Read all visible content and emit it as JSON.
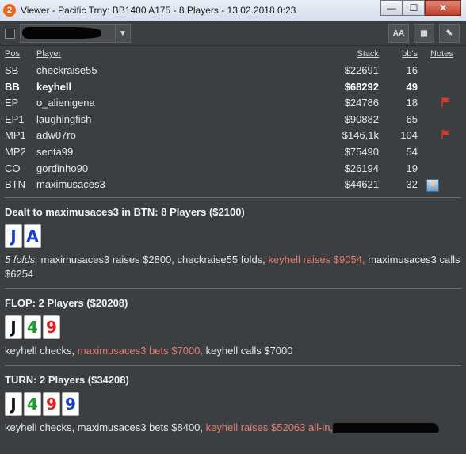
{
  "window": {
    "icon_label": "2",
    "title": "Viewer - Pacific Trny: BB1400 A175 - 8 Players - 13.02.2018 0:23",
    "min_label": "—",
    "max_label": "☐",
    "close_label": "✕"
  },
  "toolbar": {
    "dropdown_arrow": "▼",
    "font_button": "AA",
    "grid_button": "▦",
    "edit_button": "✎"
  },
  "table_header": {
    "pos": "Pos",
    "player": "Player",
    "stack": "Stack",
    "bbs": "bb's",
    "notes": "Notes"
  },
  "players": [
    {
      "pos": "SB",
      "name": "checkraise55",
      "stack": "$22691",
      "bbs": "16",
      "note": "",
      "bold": false
    },
    {
      "pos": "BB",
      "name": "keyhell",
      "stack": "$68292",
      "bbs": "49",
      "note": "",
      "bold": true
    },
    {
      "pos": "EP",
      "name": "o_alienigena",
      "stack": "$24786",
      "bbs": "18",
      "note": "red-flag-icon",
      "bold": false
    },
    {
      "pos": "EP1",
      "name": "laughingfish",
      "stack": "$90882",
      "bbs": "65",
      "note": "",
      "bold": false
    },
    {
      "pos": "MP1",
      "name": "adw07ro",
      "stack": "$146,1k",
      "bbs": "104",
      "note": "red-flag-icon",
      "bold": false
    },
    {
      "pos": "MP2",
      "name": "senta99",
      "stack": "$75490",
      "bbs": "54",
      "note": "",
      "bold": false
    },
    {
      "pos": "CO",
      "name": "gordinho90",
      "stack": "$26194",
      "bbs": "19",
      "note": "",
      "bold": false
    },
    {
      "pos": "BTN",
      "name": "maximusaces3",
      "stack": "$44621",
      "bbs": "32",
      "note": "avatar-icon",
      "bold": false
    }
  ],
  "preflop": {
    "title": "Dealt to maximusaces3 in BTN: 8 Players ($2100)",
    "cards": [
      {
        "rank": "J",
        "suit": "d"
      },
      {
        "rank": "A",
        "suit": "d"
      }
    ],
    "text_1": "5 folds,",
    "text_2": " maximusaces3 raises $2800, checkraise55 folds, ",
    "text_3": "keyhell raises $9054,",
    "text_4": " maximusaces3 calls $6254"
  },
  "flop": {
    "title": "FLOP: 2 Players ($20208)",
    "cards": [
      {
        "rank": "J",
        "suit": "s"
      },
      {
        "rank": "4",
        "suit": "c"
      },
      {
        "rank": "9",
        "suit": "h"
      }
    ],
    "text_1": "keyhell checks, ",
    "text_2": "maximusaces3 bets $7000,",
    "text_3": " keyhell calls $7000"
  },
  "turn": {
    "title": "TURN: 2 Players ($34208)",
    "cards": [
      {
        "rank": "J",
        "suit": "s"
      },
      {
        "rank": "4",
        "suit": "c"
      },
      {
        "rank": "9",
        "suit": "h"
      },
      {
        "rank": "9",
        "suit": "d"
      }
    ],
    "text_1": "keyhell checks, maximusaces3 bets $8400, ",
    "text_2": "keyhell raises $52063 all-in,"
  }
}
